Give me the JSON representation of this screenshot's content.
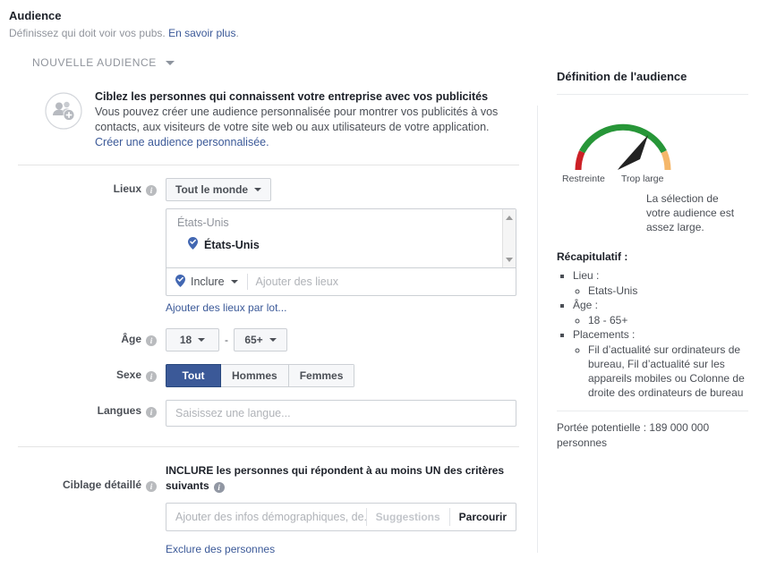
{
  "header": {
    "title": "Audience",
    "subtitle_text": "Définissez qui doit voir vos pubs.",
    "subtitle_link": "En savoir plus",
    "subtitle_period": "."
  },
  "audience_selector": {
    "label": "NOUVELLE AUDIENCE"
  },
  "promo": {
    "icon": "people-add-icon",
    "title": "Ciblez les personnes qui connaissent votre entreprise avec vos publicités",
    "body": "Vous pouvez créer une audience personnalisée pour montrer vos publicités à vos contacts, aux visiteurs de votre site web ou aux utilisateurs de votre application.",
    "link": "Créer une audience personnalisée.",
    "link_text_only": "Créer une audience personnalisée"
  },
  "form": {
    "places": {
      "label": "Lieux",
      "scope_button": "Tout le monde",
      "list_title": "États-Unis",
      "selected_item": "États-Unis",
      "include_label": "Inclure",
      "add_placeholder": "Ajouter des lieux",
      "bulk_link": "Ajouter des lieux par lot..."
    },
    "age": {
      "label": "Âge",
      "min": "18",
      "max": "65+",
      "separator": "-"
    },
    "gender": {
      "label": "Sexe",
      "options": [
        "Tout",
        "Hommes",
        "Femmes"
      ],
      "selected": "Tout"
    },
    "languages": {
      "label": "Langues",
      "placeholder": "Saisissez une langue..."
    },
    "detailed_targeting": {
      "label": "Ciblage détaillé",
      "heading": "INCLURE les personnes qui répondent à au moins UN des critères suivants",
      "field_placeholder": "Ajouter des infos démographiques, de...",
      "suggestions_label": "Suggestions",
      "browse_label": "Parcourir",
      "exclude_link": "Exclure des personnes"
    }
  },
  "right_panel": {
    "title": "Définition de l'audience",
    "gauge": {
      "left_label": "Restreinte",
      "right_label": "Trop large",
      "note": "La sélection de votre audience est assez large.",
      "color_low": "#cc2026",
      "color_good": "#279638",
      "color_high": "#f5b76a",
      "needle_color": "#222222"
    },
    "summary": {
      "title": "Récapitulatif :",
      "items": [
        {
          "label": "Lieu :",
          "values": [
            "Etats-Unis"
          ]
        },
        {
          "label": "Âge :",
          "values": [
            "18 - 65+"
          ]
        },
        {
          "label": "Placements :",
          "values": [
            "Fil d’actualité sur ordinateurs de bureau, Fil d’actualité sur les appareils mobiles ou Colonne de droite des ordinateurs de bureau"
          ]
        }
      ]
    },
    "reach": "Portée potentielle : 189 000 000 personnes"
  },
  "colors": {
    "brand_blue": "#3b5998",
    "link_blue": "#3b5998",
    "text_dark": "#1d2129",
    "text_muted": "#90949c",
    "border": "#ccd0d5"
  }
}
